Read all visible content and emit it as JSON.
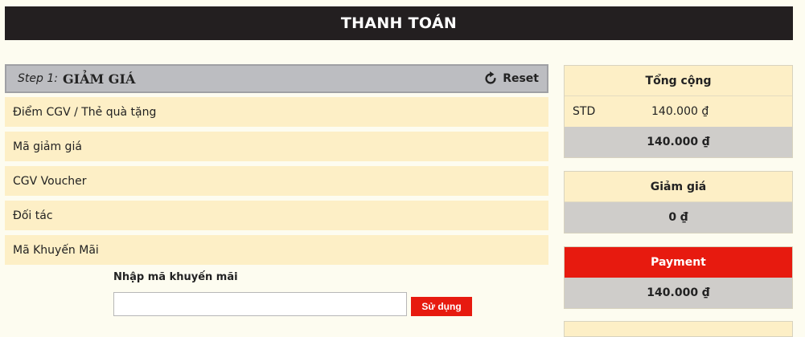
{
  "header": {
    "title": "THANH TOÁN"
  },
  "step": {
    "prefix": "Step 1:",
    "title": "GIẢM GIÁ",
    "reset_label": "Reset"
  },
  "options": [
    {
      "label": "Điểm CGV / Thẻ quà tặng"
    },
    {
      "label": "Mã giảm giá"
    },
    {
      "label": "CGV Voucher"
    },
    {
      "label": "Đối tác"
    },
    {
      "label": "Mã Khuyến Mãi"
    }
  ],
  "promo": {
    "label": "Nhập mã khuyến mãi",
    "value": "",
    "placeholder": "",
    "apply_label": "Sử dụng"
  },
  "summary": {
    "total": {
      "title": "Tổng cộng",
      "line_label": "STD",
      "line_amount": "140.000 ₫",
      "amount": "140.000 ₫"
    },
    "discount": {
      "title": "Giảm giá",
      "amount": "0 ₫"
    },
    "payment": {
      "title": "Payment",
      "amount": "140.000 ₫"
    }
  },
  "colors": {
    "title_bar": "#231f20",
    "accent_red": "#e71a0f",
    "row_bg": "#fdefc6",
    "step_bg": "#bcbdc1",
    "total_bg": "#cfcdca",
    "page_bg": "#fdfcf0"
  },
  "icons": {
    "reset": "refresh-icon"
  }
}
